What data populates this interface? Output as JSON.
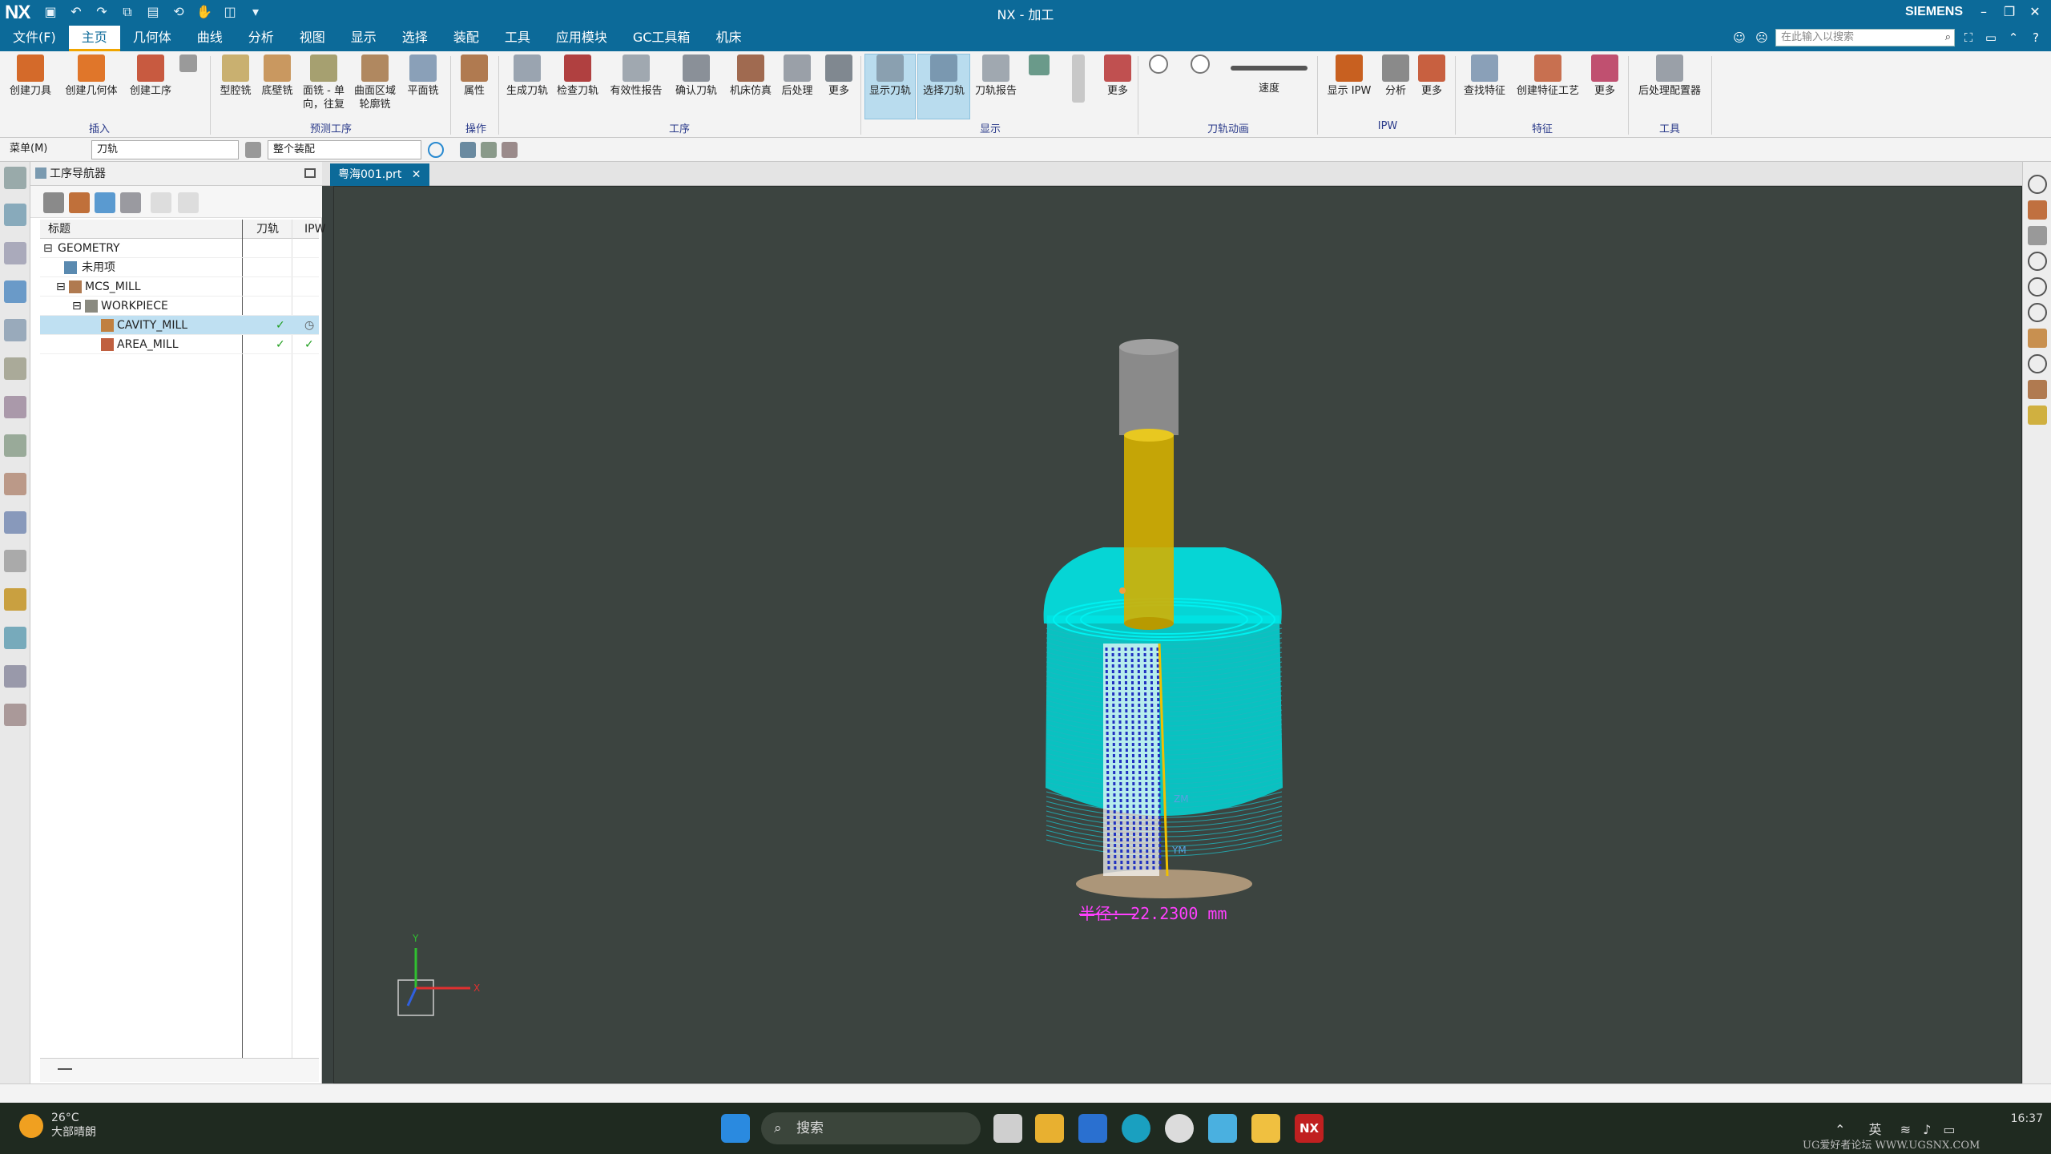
{
  "window": {
    "title": "NX - 加工",
    "brand": "SIEMENS",
    "logo": "NX"
  },
  "menubar": {
    "items": [
      "文件(F)",
      "主页",
      "几何体",
      "曲线",
      "分析",
      "视图",
      "显示",
      "选择",
      "装配",
      "工具",
      "应用模块",
      "GC工具箱",
      "机床"
    ],
    "active": "主页",
    "search_placeholder": "在此输入以搜索"
  },
  "ribbon": {
    "buttons": [
      {
        "label": "创建刀具"
      },
      {
        "label": "创建几何体"
      },
      {
        "label": "创建工序"
      },
      {
        "label": "型腔铣"
      },
      {
        "label": "底壁铣"
      },
      {
        "label": "面铣 - 单\n向，往复"
      },
      {
        "label": "曲面区域\n轮廓铣"
      },
      {
        "label": "平面铣"
      },
      {
        "label": "属性"
      },
      {
        "label": "生成刀轨"
      },
      {
        "label": "检查刀轨"
      },
      {
        "label": "有效性报告"
      },
      {
        "label": "确认刀轨"
      },
      {
        "label": "机床仿真"
      },
      {
        "label": "后处理"
      },
      {
        "label": "更多"
      },
      {
        "label": "显示刀轨"
      },
      {
        "label": "选择刀轨"
      },
      {
        "label": "刀轨报告"
      },
      {
        "label": "更多"
      },
      {
        "label": "速度"
      },
      {
        "label": "显示 IPW"
      },
      {
        "label": "分析"
      },
      {
        "label": "更多"
      },
      {
        "label": "查找特征"
      },
      {
        "label": "创建特征工艺"
      },
      {
        "label": "更多"
      },
      {
        "label": "后处理配置器"
      }
    ],
    "groups": [
      "插入",
      "预测工序",
      "操作",
      "工序",
      "显示",
      "刀轨动画",
      "IPW",
      "特征",
      "工具"
    ]
  },
  "toolbar2": {
    "menu": "菜单(M)",
    "filter": "刀轨",
    "scope": "整个装配"
  },
  "navigator": {
    "title": "工序导航器",
    "columns": [
      "标题",
      "刀轨",
      "IPW"
    ],
    "rows": [
      {
        "name": "GEOMETRY",
        "indent": 0
      },
      {
        "name": "未用项",
        "indent": 1
      },
      {
        "name": "MCS_MILL",
        "indent": 1
      },
      {
        "name": "WORKPIECE",
        "indent": 2
      },
      {
        "name": "CAVITY_MILL",
        "indent": 3,
        "toolpath": "✓",
        "ipw": "◷",
        "selected": true
      },
      {
        "name": "AREA_MILL",
        "indent": 3,
        "toolpath": "✓",
        "ipw": "✓"
      }
    ]
  },
  "viewport": {
    "tab": "粤海001.prt",
    "measure_text": "半径: 22.2300 mm",
    "axis_labels": {
      "x": "X",
      "y": "Y",
      "zm": "ZM",
      "ym": "YM"
    }
  },
  "colors": {
    "accent": "#0c6a99",
    "toolpath": "#00e5e5",
    "tool_body": "#d4b000",
    "holder": "#8a8a8a",
    "measure": "#ff40ff"
  },
  "taskbar": {
    "weather_temp": "26°C",
    "weather_text": "大部晴朗",
    "search": "搜索",
    "ime": "英",
    "time": "16:37",
    "watermark": "UG爱好者论坛 WWW.UGSNX.COM"
  }
}
